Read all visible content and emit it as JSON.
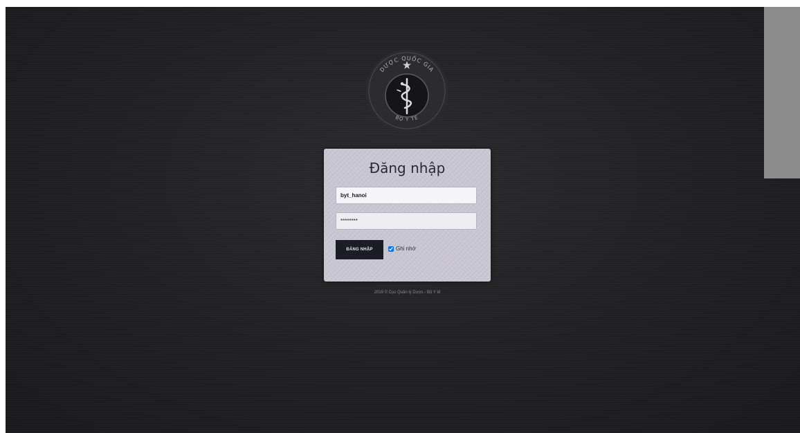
{
  "seal": {
    "top_text": "DƯỢC QUỐC GIA",
    "bottom_text": "BỘ Y TẾ",
    "colors": {
      "ring": "#3a3a3e",
      "inner": "#18181a",
      "emblem": "#d8d8d8"
    }
  },
  "login": {
    "title": "Đăng nhập",
    "username_value": "byt_hanoi",
    "password_value": "********",
    "submit_label": "ĐĂNG NHẬP",
    "remember_label": "Ghi nhớ",
    "remember_checked": true
  },
  "footer": {
    "text": "2019 © Cục Quản lý Dược - Bộ Y tế"
  },
  "colors": {
    "background": "#202022",
    "card": "#c9c6d3",
    "button": "#1c1c24",
    "side_panel": "#8c8c8c"
  }
}
